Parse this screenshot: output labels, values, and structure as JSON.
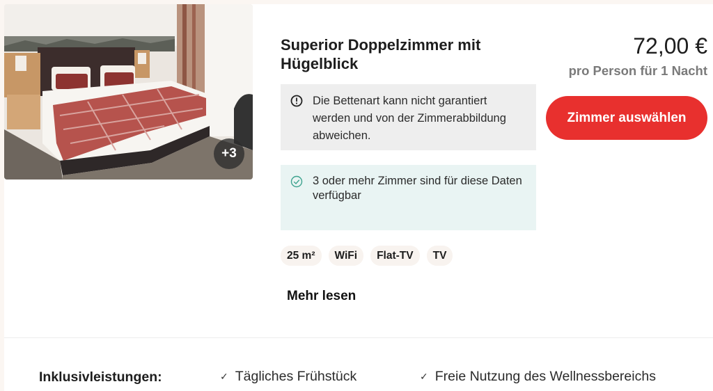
{
  "room": {
    "title": "Superior Doppelzimmer mit Hügelblick",
    "extra_photos": "+3"
  },
  "notice": {
    "icon": "info-icon",
    "text": "Die Bettenart kann nicht garantiert werden und von der Zimmerabbildung abweichen."
  },
  "availability": {
    "icon": "check-circle-icon",
    "text": "3 oder mehr Zimmer sind für diese Daten verfügbar",
    "color": "#3ea38f"
  },
  "amenities": [
    "25 m²",
    "WiFi",
    "Flat-TV",
    "TV"
  ],
  "more_link": "Mehr lesen",
  "pricing": {
    "price": "72,00 €",
    "per": "pro Person für 1 Nacht",
    "button_label": "Zimmer auswählen",
    "button_color": "#e8302e"
  },
  "inclusions": {
    "label": "Inklusivleistungen:",
    "items": [
      "Tägliches Frühstück",
      "Freie Nutzung des Wellnessbereichs"
    ]
  }
}
